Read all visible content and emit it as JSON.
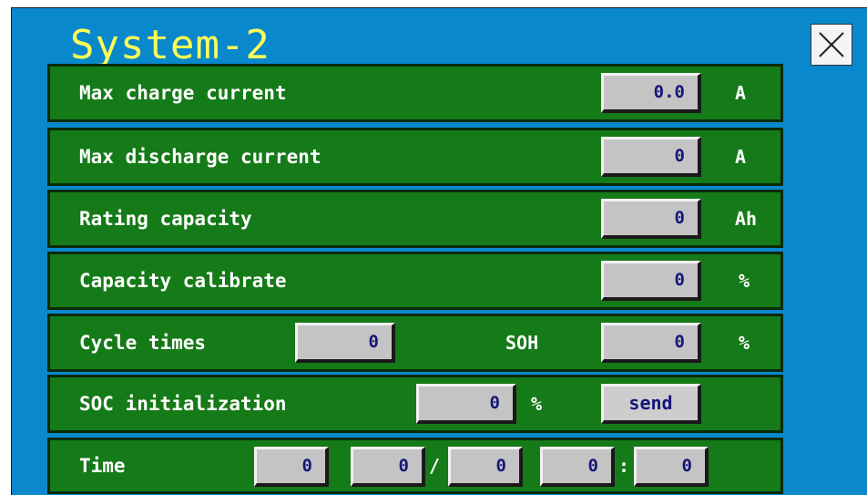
{
  "window": {
    "title": "System-2"
  },
  "rows": [
    {
      "label": "Max charge current",
      "value": "0.0",
      "unit": "A"
    },
    {
      "label": "Max discharge current",
      "value": "0",
      "unit": "A"
    },
    {
      "label": "Rating capacity",
      "value": "0",
      "unit": "Ah"
    },
    {
      "label": "Capacity calibrate",
      "value": "0",
      "unit": "%"
    }
  ],
  "cycle": {
    "label": "Cycle times",
    "value": "0",
    "soh_label": "SOH",
    "soh_value": "0",
    "soh_unit": "%"
  },
  "soc": {
    "label": "SOC initialization",
    "value": "0",
    "unit": "%",
    "send_label": "send"
  },
  "time": {
    "label": "Time",
    "fields": [
      "0",
      "0",
      "0",
      "0",
      "0"
    ],
    "sep_date": "/",
    "sep_time": ":"
  },
  "colors": {
    "background": "#0a88cc",
    "row": "#157a18",
    "title": "#ffff55",
    "field_text": "#15157a"
  },
  "icons": {
    "close": "close-x-icon"
  }
}
